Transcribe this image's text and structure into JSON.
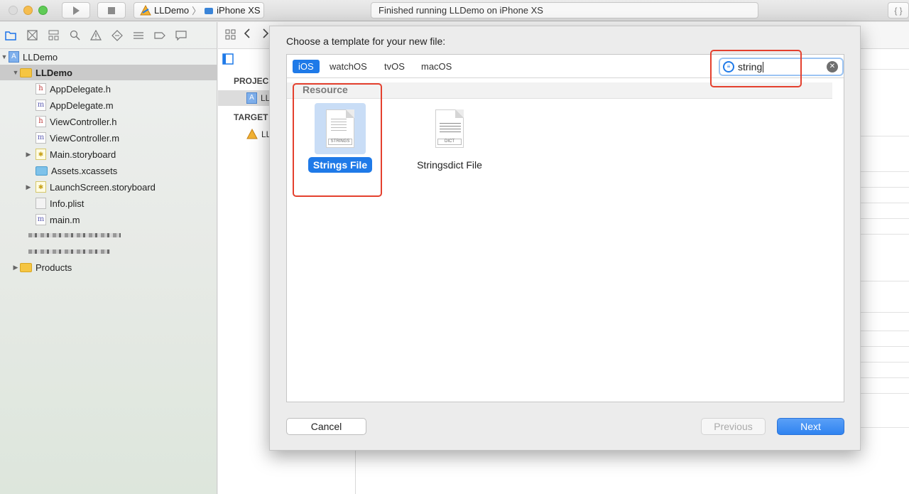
{
  "toolbar": {
    "scheme_project": "LLDemo",
    "scheme_device": "iPhone XS",
    "status_text": "Finished running LLDemo on iPhone XS",
    "braces": "{ }"
  },
  "navigator": {
    "root": "LLDemo",
    "group": "LLDemo",
    "files": [
      {
        "name": "AppDelegate.h",
        "icon": "h"
      },
      {
        "name": "AppDelegate.m",
        "icon": "m"
      },
      {
        "name": "ViewController.h",
        "icon": "h"
      },
      {
        "name": "ViewController.m",
        "icon": "m"
      },
      {
        "name": "Main.storyboard",
        "icon": "storyboard"
      },
      {
        "name": "Assets.xcassets",
        "icon": "assets"
      },
      {
        "name": "LaunchScreen.storyboard",
        "icon": "storyboard"
      },
      {
        "name": "Info.plist",
        "icon": "plist"
      },
      {
        "name": "main.m",
        "icon": "m"
      }
    ],
    "products": "Products"
  },
  "editor": {
    "project_label": "PROJEC",
    "project_item": "LL",
    "targets_label": "TARGET",
    "target_item": "LL"
  },
  "dialog": {
    "title": "Choose a template for your new file:",
    "platform_tabs": [
      "iOS",
      "watchOS",
      "tvOS",
      "macOS"
    ],
    "selected_tab": "iOS",
    "search_value": "string",
    "section": "Resource",
    "templates": [
      {
        "name": "Strings File",
        "badge": "STRINGS",
        "selected": true
      },
      {
        "name": "Stringsdict File",
        "badge": "DICT",
        "selected": false
      }
    ],
    "cancel_label": "Cancel",
    "previous_label": "Previous",
    "next_label": "Next"
  },
  "colors": {
    "accent": "#1f7ae8",
    "annotation": "#e4402e"
  }
}
